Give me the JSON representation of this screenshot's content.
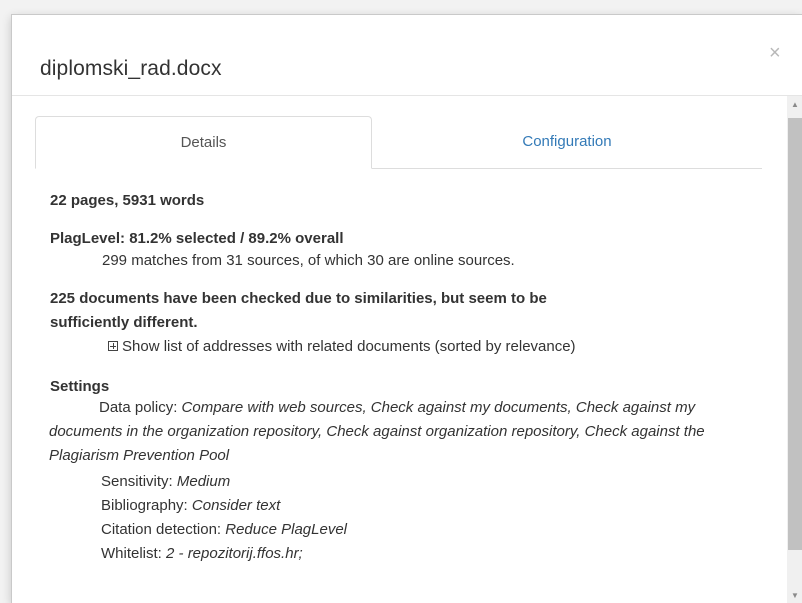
{
  "dialog": {
    "title": "diplomski_rad.docx",
    "close_label": "×"
  },
  "tabs": [
    {
      "label": "Details",
      "active": true
    },
    {
      "label": "Configuration",
      "active": false
    }
  ],
  "details": {
    "summary": "22 pages, 5931 words",
    "plaglevel": "PlagLevel: 81.2% selected / 89.2% overall",
    "matches": "299 matches from 31 sources, of which 30 are online sources.",
    "checked_line1": "225 documents have been checked due to similarities, but seem to be",
    "checked_line2": "sufficiently different.",
    "show_list": "Show list of addresses with related documents (sorted by relevance)",
    "settings_heading": "Settings",
    "data_policy_label": "Data policy:",
    "data_policy_value": "Compare with web sources, Check against my documents, Check against my documents in the organization repository, Check against organization repository, Check against the Plagiarism Prevention Pool",
    "sensitivity_label": "Sensitivity:",
    "sensitivity_value": "Medium",
    "bibliography_label": "Bibliography:",
    "bibliography_value": "Consider text",
    "citation_label": "Citation detection:",
    "citation_value": "Reduce PlagLevel",
    "whitelist_label": "Whitelist:",
    "whitelist_value": "2 - repozitorij.ffos.hr;"
  },
  "icons": {
    "expand": "plus-square-icon",
    "close": "close-icon",
    "scroll_up": "arrow-up-icon",
    "scroll_down": "arrow-down-icon"
  },
  "colors": {
    "link": "#337ab7",
    "text": "#333333",
    "border": "#dddddd"
  }
}
